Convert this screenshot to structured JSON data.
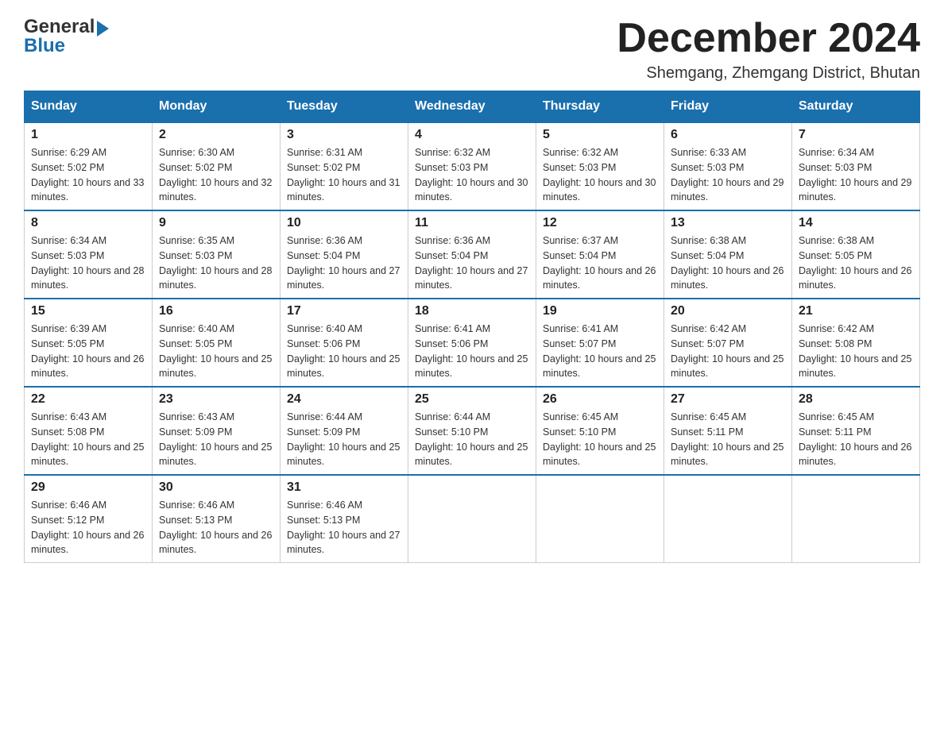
{
  "header": {
    "logo_general": "General",
    "logo_blue": "Blue",
    "month_title": "December 2024",
    "subtitle": "Shemgang, Zhemgang District, Bhutan"
  },
  "days_of_week": [
    "Sunday",
    "Monday",
    "Tuesday",
    "Wednesday",
    "Thursday",
    "Friday",
    "Saturday"
  ],
  "weeks": [
    [
      {
        "day": "1",
        "sunrise": "6:29 AM",
        "sunset": "5:02 PM",
        "daylight": "10 hours and 33 minutes."
      },
      {
        "day": "2",
        "sunrise": "6:30 AM",
        "sunset": "5:02 PM",
        "daylight": "10 hours and 32 minutes."
      },
      {
        "day": "3",
        "sunrise": "6:31 AM",
        "sunset": "5:02 PM",
        "daylight": "10 hours and 31 minutes."
      },
      {
        "day": "4",
        "sunrise": "6:32 AM",
        "sunset": "5:03 PM",
        "daylight": "10 hours and 30 minutes."
      },
      {
        "day": "5",
        "sunrise": "6:32 AM",
        "sunset": "5:03 PM",
        "daylight": "10 hours and 30 minutes."
      },
      {
        "day": "6",
        "sunrise": "6:33 AM",
        "sunset": "5:03 PM",
        "daylight": "10 hours and 29 minutes."
      },
      {
        "day": "7",
        "sunrise": "6:34 AM",
        "sunset": "5:03 PM",
        "daylight": "10 hours and 29 minutes."
      }
    ],
    [
      {
        "day": "8",
        "sunrise": "6:34 AM",
        "sunset": "5:03 PM",
        "daylight": "10 hours and 28 minutes."
      },
      {
        "day": "9",
        "sunrise": "6:35 AM",
        "sunset": "5:03 PM",
        "daylight": "10 hours and 28 minutes."
      },
      {
        "day": "10",
        "sunrise": "6:36 AM",
        "sunset": "5:04 PM",
        "daylight": "10 hours and 27 minutes."
      },
      {
        "day": "11",
        "sunrise": "6:36 AM",
        "sunset": "5:04 PM",
        "daylight": "10 hours and 27 minutes."
      },
      {
        "day": "12",
        "sunrise": "6:37 AM",
        "sunset": "5:04 PM",
        "daylight": "10 hours and 26 minutes."
      },
      {
        "day": "13",
        "sunrise": "6:38 AM",
        "sunset": "5:04 PM",
        "daylight": "10 hours and 26 minutes."
      },
      {
        "day": "14",
        "sunrise": "6:38 AM",
        "sunset": "5:05 PM",
        "daylight": "10 hours and 26 minutes."
      }
    ],
    [
      {
        "day": "15",
        "sunrise": "6:39 AM",
        "sunset": "5:05 PM",
        "daylight": "10 hours and 26 minutes."
      },
      {
        "day": "16",
        "sunrise": "6:40 AM",
        "sunset": "5:05 PM",
        "daylight": "10 hours and 25 minutes."
      },
      {
        "day": "17",
        "sunrise": "6:40 AM",
        "sunset": "5:06 PM",
        "daylight": "10 hours and 25 minutes."
      },
      {
        "day": "18",
        "sunrise": "6:41 AM",
        "sunset": "5:06 PM",
        "daylight": "10 hours and 25 minutes."
      },
      {
        "day": "19",
        "sunrise": "6:41 AM",
        "sunset": "5:07 PM",
        "daylight": "10 hours and 25 minutes."
      },
      {
        "day": "20",
        "sunrise": "6:42 AM",
        "sunset": "5:07 PM",
        "daylight": "10 hours and 25 minutes."
      },
      {
        "day": "21",
        "sunrise": "6:42 AM",
        "sunset": "5:08 PM",
        "daylight": "10 hours and 25 minutes."
      }
    ],
    [
      {
        "day": "22",
        "sunrise": "6:43 AM",
        "sunset": "5:08 PM",
        "daylight": "10 hours and 25 minutes."
      },
      {
        "day": "23",
        "sunrise": "6:43 AM",
        "sunset": "5:09 PM",
        "daylight": "10 hours and 25 minutes."
      },
      {
        "day": "24",
        "sunrise": "6:44 AM",
        "sunset": "5:09 PM",
        "daylight": "10 hours and 25 minutes."
      },
      {
        "day": "25",
        "sunrise": "6:44 AM",
        "sunset": "5:10 PM",
        "daylight": "10 hours and 25 minutes."
      },
      {
        "day": "26",
        "sunrise": "6:45 AM",
        "sunset": "5:10 PM",
        "daylight": "10 hours and 25 minutes."
      },
      {
        "day": "27",
        "sunrise": "6:45 AM",
        "sunset": "5:11 PM",
        "daylight": "10 hours and 25 minutes."
      },
      {
        "day": "28",
        "sunrise": "6:45 AM",
        "sunset": "5:11 PM",
        "daylight": "10 hours and 26 minutes."
      }
    ],
    [
      {
        "day": "29",
        "sunrise": "6:46 AM",
        "sunset": "5:12 PM",
        "daylight": "10 hours and 26 minutes."
      },
      {
        "day": "30",
        "sunrise": "6:46 AM",
        "sunset": "5:13 PM",
        "daylight": "10 hours and 26 minutes."
      },
      {
        "day": "31",
        "sunrise": "6:46 AM",
        "sunset": "5:13 PM",
        "daylight": "10 hours and 27 minutes."
      },
      null,
      null,
      null,
      null
    ]
  ]
}
